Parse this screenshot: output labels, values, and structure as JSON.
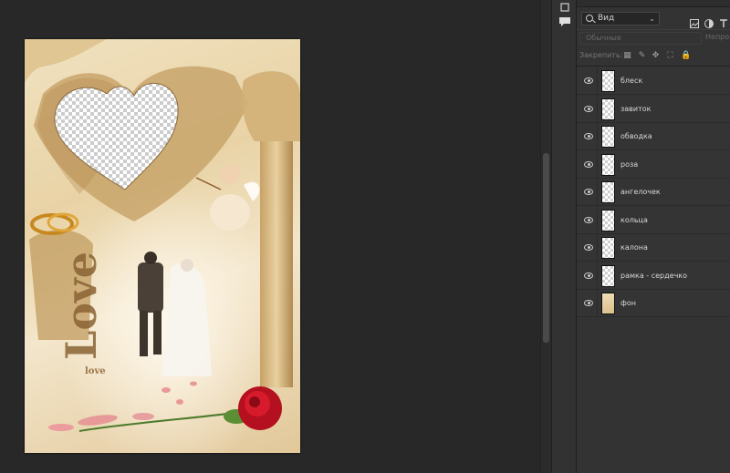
{
  "layers_panel": {
    "filter": {
      "value": "Вид"
    },
    "blend_mode": "Обычные",
    "opacity_label": "Непрозр",
    "lock_label": "Закрепить:",
    "layers": [
      {
        "name": "блеск",
        "visible": true,
        "thumb": "transparent"
      },
      {
        "name": "завиток",
        "visible": true,
        "thumb": "transparent"
      },
      {
        "name": "обводка",
        "visible": true,
        "thumb": "transparent"
      },
      {
        "name": "роза",
        "visible": true,
        "thumb": "transparent"
      },
      {
        "name": "ангелочек",
        "visible": true,
        "thumb": "transparent"
      },
      {
        "name": "кольца",
        "visible": true,
        "thumb": "transparent"
      },
      {
        "name": "калона",
        "visible": true,
        "thumb": "transparent"
      },
      {
        "name": "рамка - сердечко",
        "visible": true,
        "thumb": "transparent"
      },
      {
        "name": "фон",
        "visible": true,
        "thumb": "photo"
      }
    ]
  },
  "document": {
    "text_large": "Love",
    "text_small": "love"
  },
  "colors": {
    "app_bg": "#282828",
    "panel_bg": "#333333",
    "accent_rose": "#c8102e"
  }
}
